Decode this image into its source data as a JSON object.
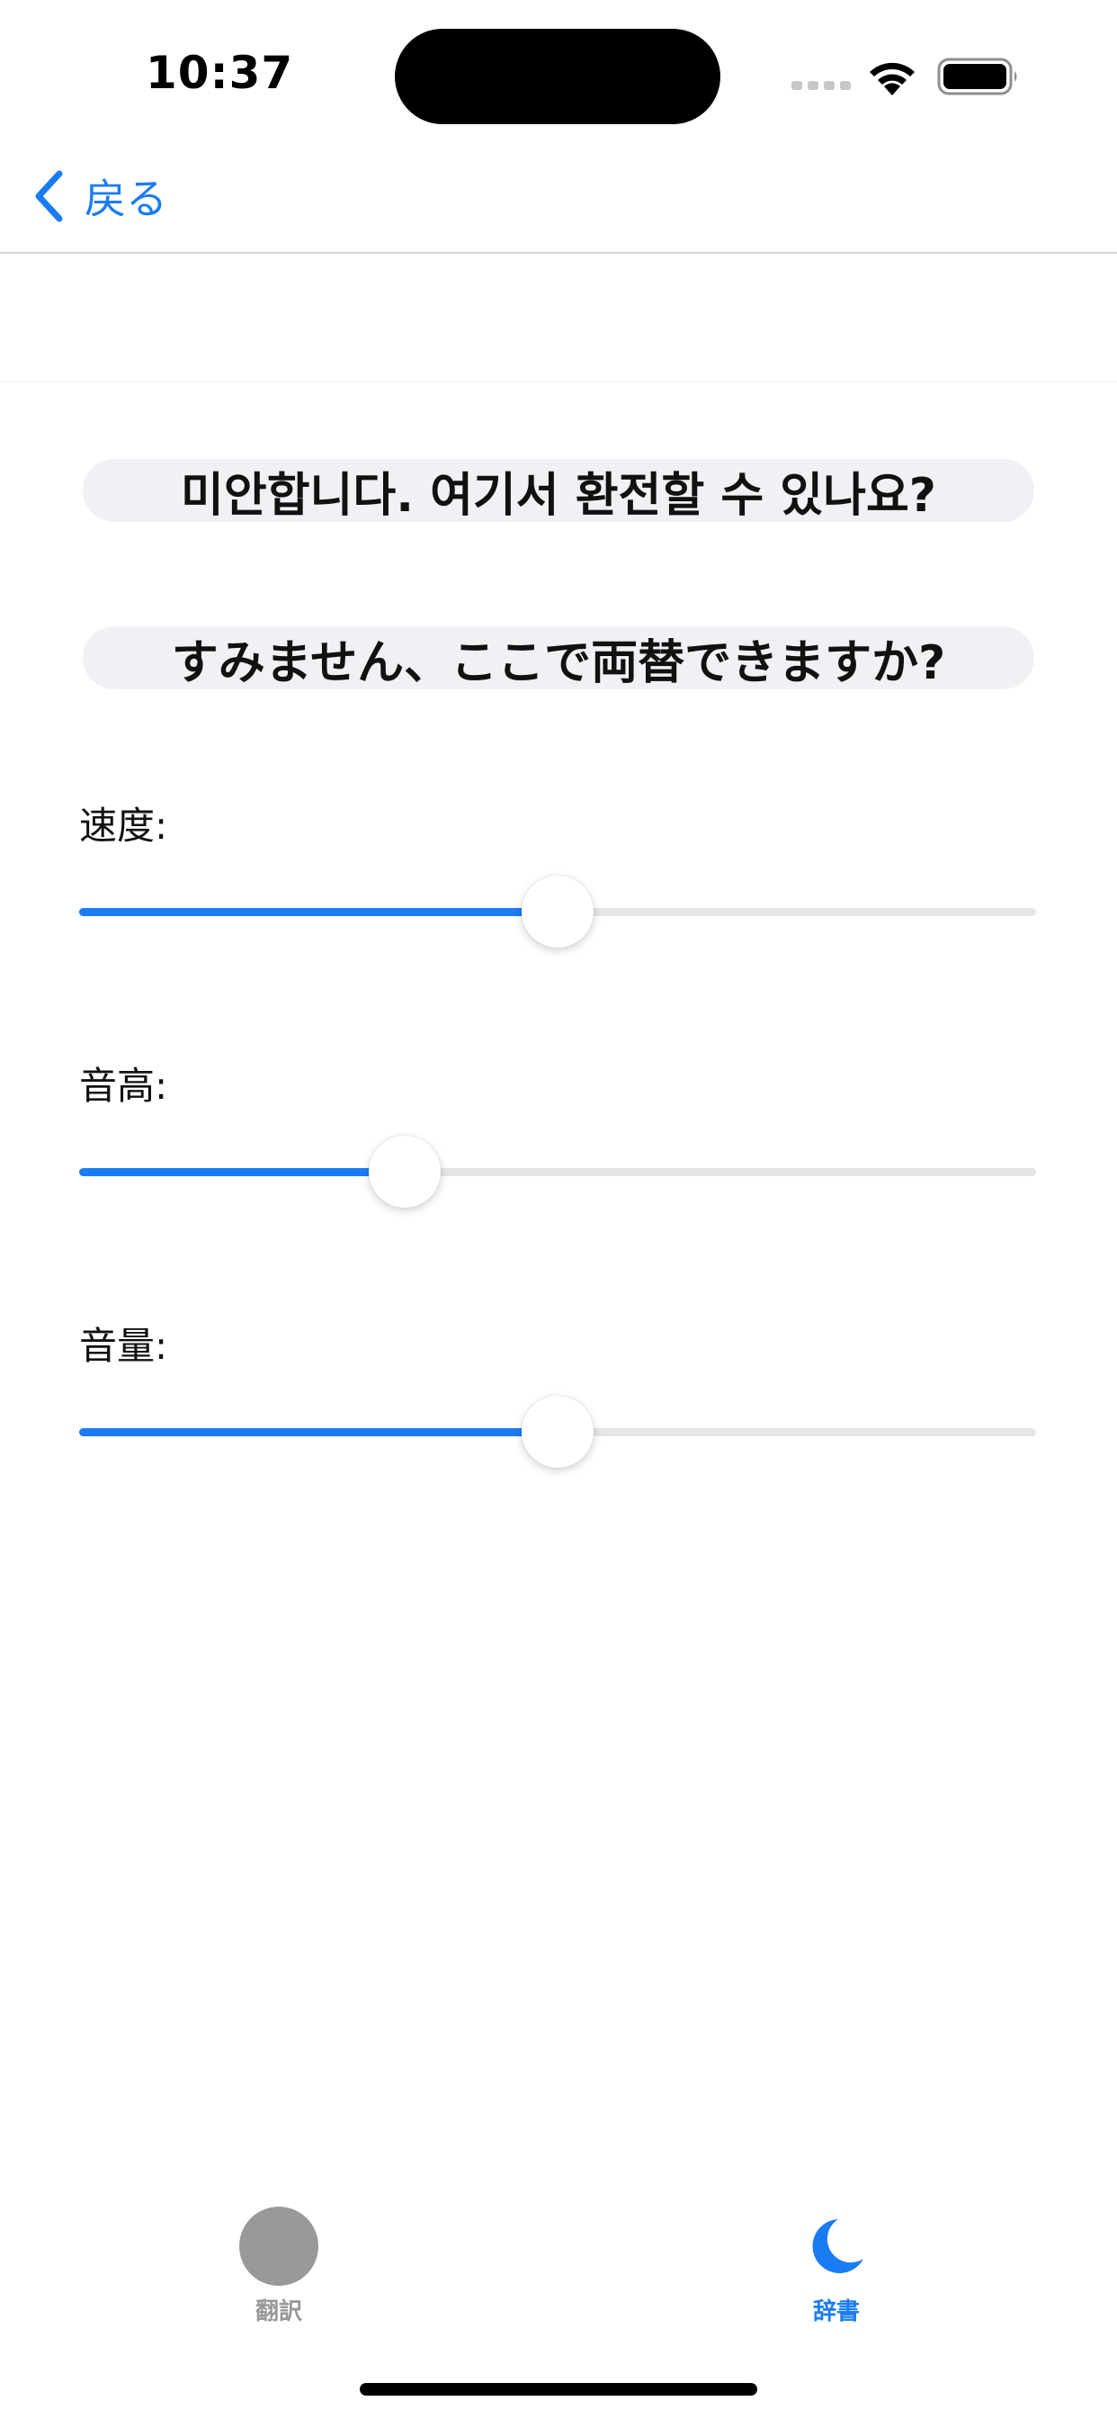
{
  "status_bar": {
    "time": "10:37"
  },
  "nav": {
    "back_label": "戻る",
    "back_icon": "chevron-left-icon"
  },
  "phrases": {
    "korean": "미안합니다. 여기서  환전할 수 있나요?",
    "japanese": "すみません、ここで両替できますか?"
  },
  "sliders": [
    {
      "label": "速度:",
      "value": 0.5
    },
    {
      "label": "音高:",
      "value": 0.34
    },
    {
      "label": "音量:",
      "value": 0.5
    }
  ],
  "tab_bar": {
    "tabs": [
      {
        "label": "翻訳",
        "icon": "circle-icon",
        "selected": false
      },
      {
        "label": "辞書",
        "icon": "moon-icon",
        "selected": true
      }
    ]
  },
  "colors": {
    "accent": "#1a7cf5",
    "inactive": "#999999",
    "pill_background": "#f1f1f5",
    "track": "#e6e6e8"
  }
}
